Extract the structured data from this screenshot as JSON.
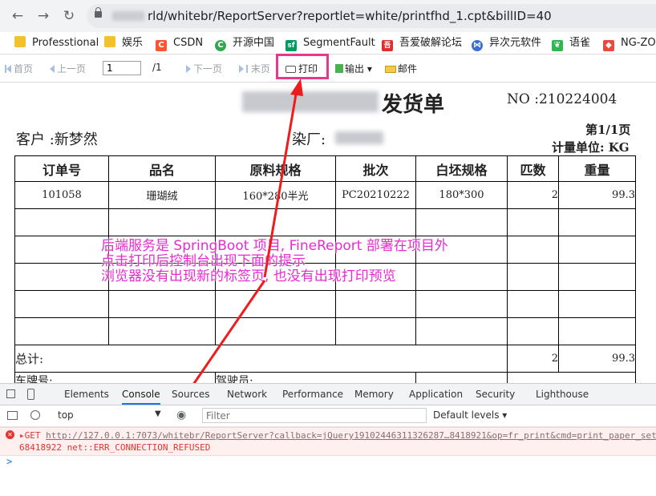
{
  "browser": {
    "nav": {
      "back": "←",
      "forward": "→",
      "reload": "↻"
    },
    "url_visible": "rld/whitebr/ReportServer?reportlet=white/printfhd_1.cpt&billID=40"
  },
  "bookmarks": [
    {
      "label": "Professtional",
      "icon": "folder-icon",
      "color": "#f2c12e"
    },
    {
      "label": "娱乐",
      "icon": "folder-icon",
      "color": "#f2c12e"
    },
    {
      "label": "CSDN",
      "icon": "csdn-icon",
      "color": "#fc5531",
      "glyph": "C"
    },
    {
      "label": "开源中国",
      "icon": "oschina-icon",
      "color": "#32a852",
      "glyph": "C"
    },
    {
      "label": "SegmentFault",
      "icon": "segmentfault-icon",
      "color": "#009a61",
      "glyph": "sf"
    },
    {
      "label": "吾爱破解论坛",
      "icon": "52pojie-icon",
      "color": "#d9302c",
      "glyph": "吾"
    },
    {
      "label": "异次元软件",
      "icon": "iplaysoft-icon",
      "color": "#3b6fd6",
      "glyph": "⋈"
    },
    {
      "label": "语雀",
      "icon": "yuque-icon",
      "color": "#31b453",
      "glyph": "❦"
    },
    {
      "label": "NG-ZOR",
      "icon": "ng-zorro-icon",
      "color": "#e84a3f",
      "glyph": "◆"
    }
  ],
  "toolbar": {
    "first": "首页",
    "prev": "上一页",
    "page_value": "1",
    "page_total": "/1",
    "next": "下一页",
    "last": "末页",
    "print": "打印",
    "export": "输出",
    "export_arrow": "▾",
    "mail": "邮件"
  },
  "report": {
    "title": "发货单",
    "no": "NO :210224004",
    "customer": "客户 :新梦然",
    "factory": "染厂:",
    "page": "第1/1页",
    "unit": "计量单位: KG",
    "headers": [
      "订单号",
      "品名",
      "原料规格",
      "批次",
      "白坯规格",
      "匹数",
      "重量"
    ],
    "rows": [
      [
        "101058",
        "珊瑚绒",
        "160*280半光",
        "PC20210222",
        "180*300",
        "2",
        "99.3"
      ]
    ],
    "total_label": "总计:",
    "total_pieces": "2",
    "total_weight": "99.3",
    "footer_left": "车牌号:",
    "footer_mid": "驾驶员:"
  },
  "annotation": {
    "line1": "后端服务是 SpringBoot 项目, FineReport 部署在项目外",
    "line2": "点击打印后控制台出现下面的提示",
    "line3": "浏览器没有出现新的标签页, 也没有出现打印预览",
    "color": "#e82ad0"
  },
  "devtools": {
    "tabs": [
      "Elements",
      "Console",
      "Sources",
      "Network",
      "Performance",
      "Memory",
      "Application",
      "Security",
      "Lighthouse"
    ],
    "active_tab": "Console",
    "context": "top",
    "filter_placeholder": "Filter",
    "levels": "Default levels ▾",
    "error_method": "▸GET",
    "error_url": "http://127.0.0.1:7073/whitebr/ReportServer?callback=jQuery19102446311326287…8418921&op=fr_print&cmd=print_paper_set",
    "error_line2_prefix": "68418922",
    "error_msg": "net::ERR_CONNECTION_REFUSED",
    "prompt": ">"
  },
  "colors": {
    "highlight_box": "#e5398d",
    "arrow": "#ee1c1c",
    "error": "#e3342f"
  }
}
